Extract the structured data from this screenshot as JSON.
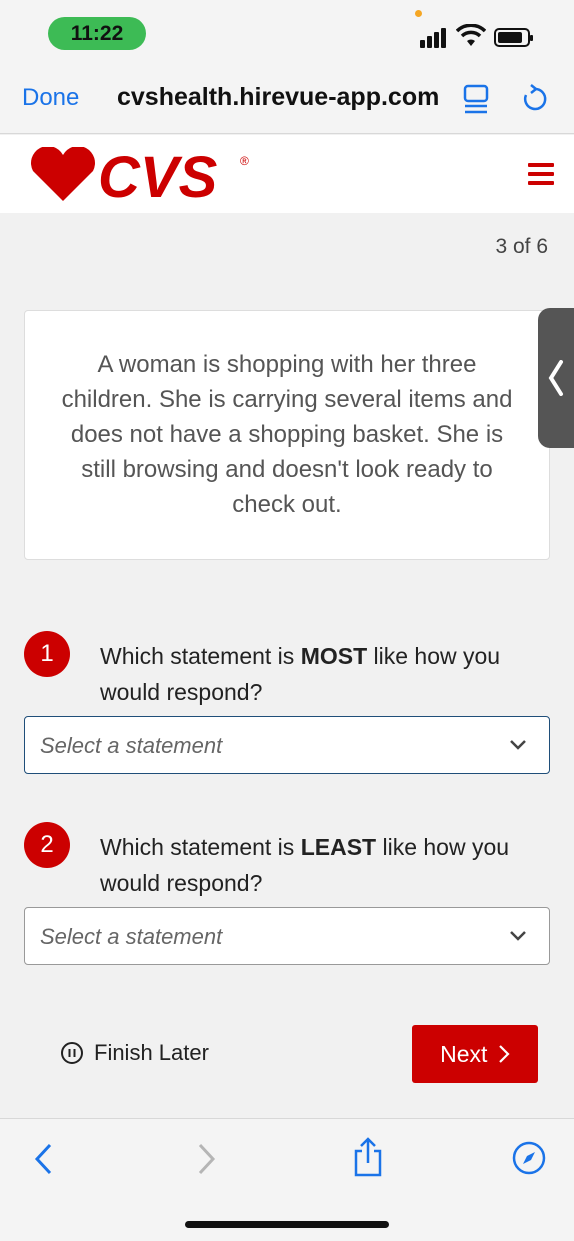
{
  "status_bar": {
    "time": "11:22"
  },
  "browser": {
    "done_label": "Done",
    "url": "cvshealth.hirevue-app.com"
  },
  "header": {
    "brand": "CVS",
    "brand_mark": "®",
    "brand_color": "#cc0000"
  },
  "progress": {
    "label": "3 of 6"
  },
  "scenario": {
    "text": "A woman is shopping with her three children. She is carrying several items and does not have a shopping basket. She is still browsing and doesn't look ready to check out."
  },
  "questions": [
    {
      "number": "1",
      "prefix": "Which statement is ",
      "emphasis": "MOST",
      "suffix": " like how you would respond?",
      "select_placeholder": "Select a statement"
    },
    {
      "number": "2",
      "prefix": "Which statement is ",
      "emphasis": "LEAST",
      "suffix": " like how you would respond?",
      "select_placeholder": "Select a statement"
    }
  ],
  "actions": {
    "finish_later": "Finish Later",
    "next": "Next"
  },
  "colors": {
    "accent": "#cc0000",
    "link": "#1a73e8"
  }
}
